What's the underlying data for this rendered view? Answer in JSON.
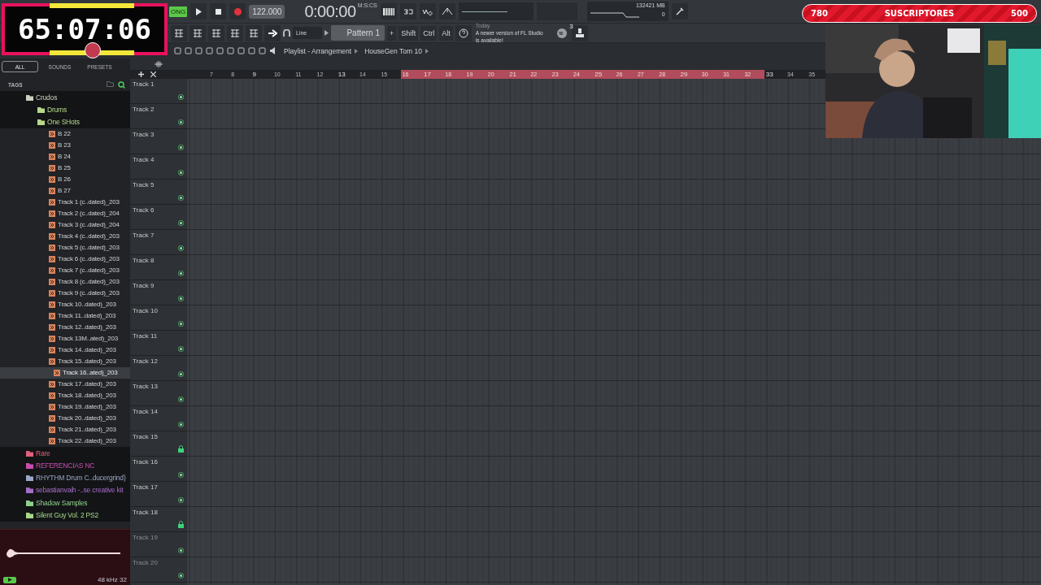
{
  "overlay_timer": {
    "time": "65:07:06"
  },
  "subscriber_goal": {
    "current": "780",
    "label": "SUSCRIPTORES",
    "goal": "500"
  },
  "toolbar": {
    "mode": "ONG",
    "tempo": "122.000",
    "time": "0:00:00",
    "time_format": "M:S:CS",
    "cpu": "13",
    "memory": "2421 MB",
    "polyphony": "0",
    "snap": "Line",
    "pattern": "Pattern 1",
    "pattern_add": "+",
    "modifiers": [
      "Shift",
      "Ctrl",
      "Alt"
    ],
    "hint_day": "Today",
    "hint": "A newer version of FL Studio is available!",
    "hint_count": "3"
  },
  "playlist": {
    "title": "Playlist - Arrangement",
    "song": "HouseGen Tom 10",
    "bars": [
      {
        "label": "7",
        "kind": "minor",
        "in_loop": false
      },
      {
        "label": "8",
        "kind": "minor",
        "in_loop": false
      },
      {
        "label": "9",
        "kind": "major",
        "in_loop": false
      },
      {
        "label": "10",
        "kind": "minor",
        "in_loop": false
      },
      {
        "label": "11",
        "kind": "minor",
        "in_loop": false
      },
      {
        "label": "12",
        "kind": "minor",
        "in_loop": false
      },
      {
        "label": "13",
        "kind": "major",
        "in_loop": false
      },
      {
        "label": "14",
        "kind": "minor",
        "in_loop": false
      },
      {
        "label": "15",
        "kind": "minor",
        "in_loop": false
      },
      {
        "label": "16",
        "kind": "minor",
        "in_loop": true
      },
      {
        "label": "17",
        "kind": "major",
        "in_loop": true
      },
      {
        "label": "18",
        "kind": "minor",
        "in_loop": true
      },
      {
        "label": "19",
        "kind": "minor",
        "in_loop": true
      },
      {
        "label": "20",
        "kind": "minor",
        "in_loop": true
      },
      {
        "label": "21",
        "kind": "major",
        "in_loop": true
      },
      {
        "label": "22",
        "kind": "minor",
        "in_loop": true
      },
      {
        "label": "23",
        "kind": "minor",
        "in_loop": true
      },
      {
        "label": "24",
        "kind": "minor",
        "in_loop": true
      },
      {
        "label": "25",
        "kind": "major",
        "in_loop": true
      },
      {
        "label": "26",
        "kind": "minor",
        "in_loop": true
      },
      {
        "label": "27",
        "kind": "minor",
        "in_loop": true
      },
      {
        "label": "28",
        "kind": "minor",
        "in_loop": true
      },
      {
        "label": "29",
        "kind": "major",
        "in_loop": true
      },
      {
        "label": "30",
        "kind": "minor",
        "in_loop": true
      },
      {
        "label": "31",
        "kind": "minor",
        "in_loop": true
      },
      {
        "label": "32",
        "kind": "minor",
        "in_loop": true
      },
      {
        "label": "33",
        "kind": "major",
        "in_loop": false
      },
      {
        "label": "34",
        "kind": "minor",
        "in_loop": false
      },
      {
        "label": "35",
        "kind": "minor",
        "in_loop": false
      }
    ],
    "tracks": [
      {
        "name": "Track 1",
        "locked": false,
        "enabled": true
      },
      {
        "name": "Track 2",
        "locked": false,
        "enabled": true
      },
      {
        "name": "Track 3",
        "locked": false,
        "enabled": true
      },
      {
        "name": "Track 4",
        "locked": false,
        "enabled": true
      },
      {
        "name": "Track 5",
        "locked": false,
        "enabled": true
      },
      {
        "name": "Track 6",
        "locked": false,
        "enabled": true
      },
      {
        "name": "Track 7",
        "locked": false,
        "enabled": true
      },
      {
        "name": "Track 8",
        "locked": false,
        "enabled": true
      },
      {
        "name": "Track 9",
        "locked": false,
        "enabled": true
      },
      {
        "name": "Track 10",
        "locked": false,
        "enabled": true
      },
      {
        "name": "Track 11",
        "locked": false,
        "enabled": true
      },
      {
        "name": "Track 12",
        "locked": false,
        "enabled": true
      },
      {
        "name": "Track 13",
        "locked": false,
        "enabled": true
      },
      {
        "name": "Track 14",
        "locked": false,
        "enabled": true
      },
      {
        "name": "Track 15",
        "locked": true,
        "enabled": true
      },
      {
        "name": "Track 16",
        "locked": false,
        "enabled": true
      },
      {
        "name": "Track 17",
        "locked": false,
        "enabled": true
      },
      {
        "name": "Track 18",
        "locked": true,
        "enabled": true
      },
      {
        "name": "Track 19",
        "locked": false,
        "enabled": false
      },
      {
        "name": "Track 20",
        "locked": false,
        "enabled": false
      }
    ]
  },
  "browser": {
    "tabs": [
      {
        "label": "ALL",
        "selected": true
      },
      {
        "label": "SOUNDS",
        "selected": false
      },
      {
        "label": "PRESETS",
        "selected": false
      }
    ],
    "tags_label": "TAGS",
    "tree": [
      {
        "label": "Crudos",
        "kind": "folder",
        "color": "#c8d2bc",
        "children": [
          {
            "label": "Drums",
            "kind": "folder",
            "color": "#b5d88a"
          },
          {
            "label": "One SHots",
            "kind": "folder",
            "color": "#b5d88a",
            "children": [
              {
                "label": "B 22",
                "kind": "file",
                "selected": false
              },
              {
                "label": "B 23",
                "kind": "file",
                "selected": false
              },
              {
                "label": "B 24",
                "kind": "file",
                "selected": false
              },
              {
                "label": "B 25",
                "kind": "file",
                "selected": false
              },
              {
                "label": "B 26",
                "kind": "file",
                "selected": false
              },
              {
                "label": "B 27",
                "kind": "file",
                "selected": false
              },
              {
                "label": "Track 1 (c..dated)_203",
                "kind": "file",
                "selected": false
              },
              {
                "label": "Track 2 (c..dated)_204",
                "kind": "file",
                "selected": false
              },
              {
                "label": "Track 3 (c..dated)_204",
                "kind": "file",
                "selected": false
              },
              {
                "label": "Track 4 (c..dated)_203",
                "kind": "file",
                "selected": false
              },
              {
                "label": "Track 5 (c..dated)_203",
                "kind": "file",
                "selected": false
              },
              {
                "label": "Track 6 (c..dated)_203",
                "kind": "file",
                "selected": false
              },
              {
                "label": "Track 7 (c..dated)_203",
                "kind": "file",
                "selected": false
              },
              {
                "label": "Track 8 (c..dated)_203",
                "kind": "file",
                "selected": false
              },
              {
                "label": "Track 9 (c..dated)_203",
                "kind": "file",
                "selected": false
              },
              {
                "label": "Track 10..dated)_203",
                "kind": "file",
                "selected": false
              },
              {
                "label": "Track 11..dated)_203",
                "kind": "file",
                "selected": false
              },
              {
                "label": "Track 12..dated)_203",
                "kind": "file",
                "selected": false
              },
              {
                "label": "Track 13M..ated)_203",
                "kind": "file",
                "selected": false
              },
              {
                "label": "Track 14..dated)_203",
                "kind": "file",
                "selected": false
              },
              {
                "label": "Track 15..dated)_203",
                "kind": "file",
                "selected": false
              },
              {
                "label": "Track 16..ated)_203",
                "kind": "file",
                "selected": true
              },
              {
                "label": "Track 17..dated)_203",
                "kind": "file",
                "selected": false
              },
              {
                "label": "Track 18..dated)_203",
                "kind": "file",
                "selected": false
              },
              {
                "label": "Track 19..dated)_203",
                "kind": "file",
                "selected": false
              },
              {
                "label": "Track 20..dated)_203",
                "kind": "file",
                "selected": false
              },
              {
                "label": "Track 21..dated)_203",
                "kind": "file",
                "selected": false
              },
              {
                "label": "Track 22..dated)_203",
                "kind": "file",
                "selected": false
              }
            ]
          }
        ]
      },
      {
        "label": "Rare",
        "kind": "folder",
        "color": "#e0607a"
      },
      {
        "label": "REFERENCIAS NC",
        "kind": "folder",
        "color": "#c84fae"
      },
      {
        "label": "RHYTHM Drum C..ducergrind)",
        "kind": "folder",
        "color": "#9aa7c8"
      },
      {
        "label": "sebastianvaih -..se creative kit",
        "kind": "folder",
        "color": "#a76bc9"
      },
      {
        "label": "Shadow Samples",
        "kind": "folder",
        "color": "#8fd18a"
      },
      {
        "label": "Silent Guy Vol. 2 PS2",
        "kind": "folder",
        "color": "#a8d88a"
      }
    ],
    "preview": {
      "format": "48 kHz 32"
    }
  }
}
